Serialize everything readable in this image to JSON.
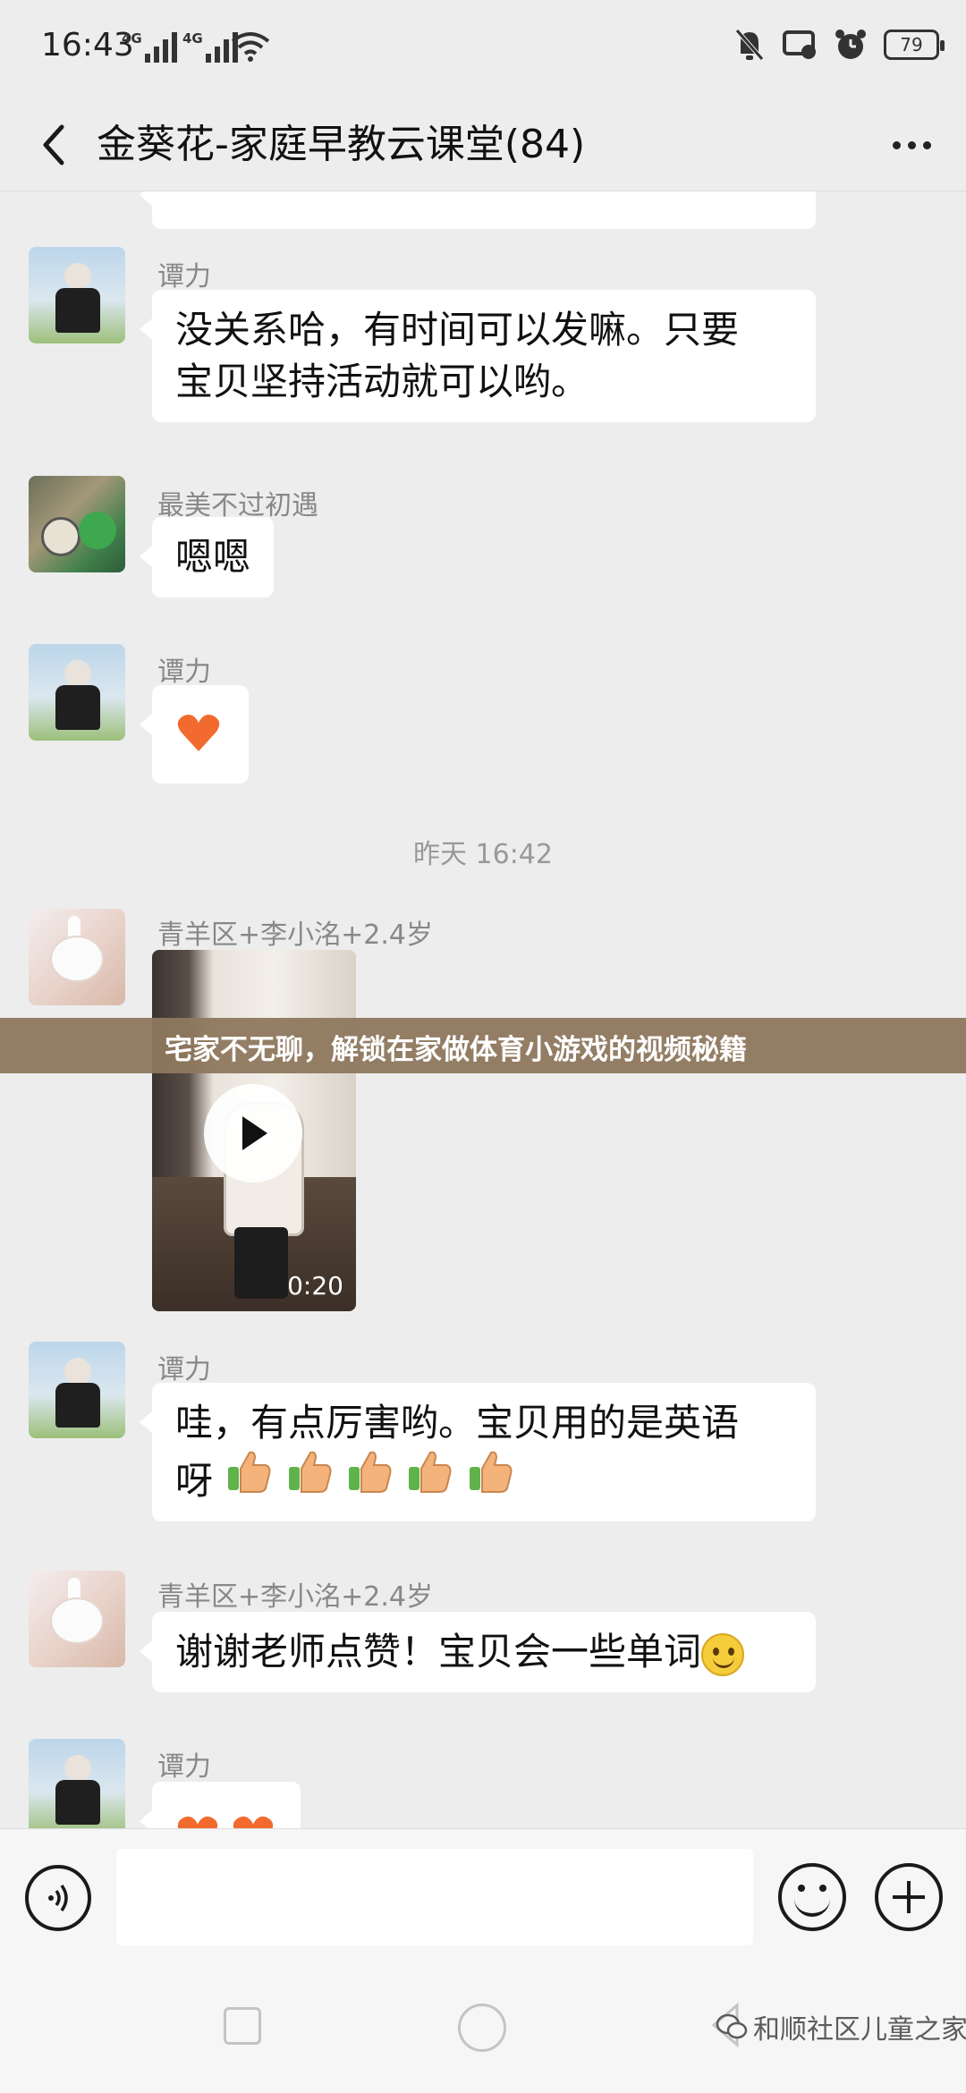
{
  "status": {
    "time": "16:43",
    "network1": "4G",
    "network2": "4G",
    "battery": "79"
  },
  "header": {
    "title": "金葵花-家庭早教云课堂(84)"
  },
  "messages": {
    "m1": {
      "sender": "谭力",
      "line1": "没关系哈，有时间可以发嘛。只要",
      "line2": "宝贝坚持活动就可以哟。"
    },
    "m2": {
      "sender": "最美不过初遇",
      "text": "嗯嗯"
    },
    "m3": {
      "sender": "谭力"
    },
    "time_divider": "昨天 16:42",
    "m4": {
      "sender": "青羊区+李小洺+2.4岁",
      "video_duration": "0:20"
    },
    "m5": {
      "sender": "谭力",
      "line1": "哇，有点厉害哟。宝贝用的是英语",
      "line2": "呀"
    },
    "m6": {
      "sender": "青羊区+李小洺+2.4岁",
      "text": "谢谢老师点赞！宝贝会一些单词"
    },
    "m7": {
      "sender": "谭力"
    }
  },
  "banner": {
    "text": "宅家不无聊，解锁在家做体育小游戏的视频秘籍"
  },
  "watermark": {
    "text": "和顺社区儿童之家"
  },
  "colors": {
    "background": "#ededed",
    "bubble": "#ffffff",
    "banner": "#8e785e",
    "heart": "#f26a2e"
  }
}
